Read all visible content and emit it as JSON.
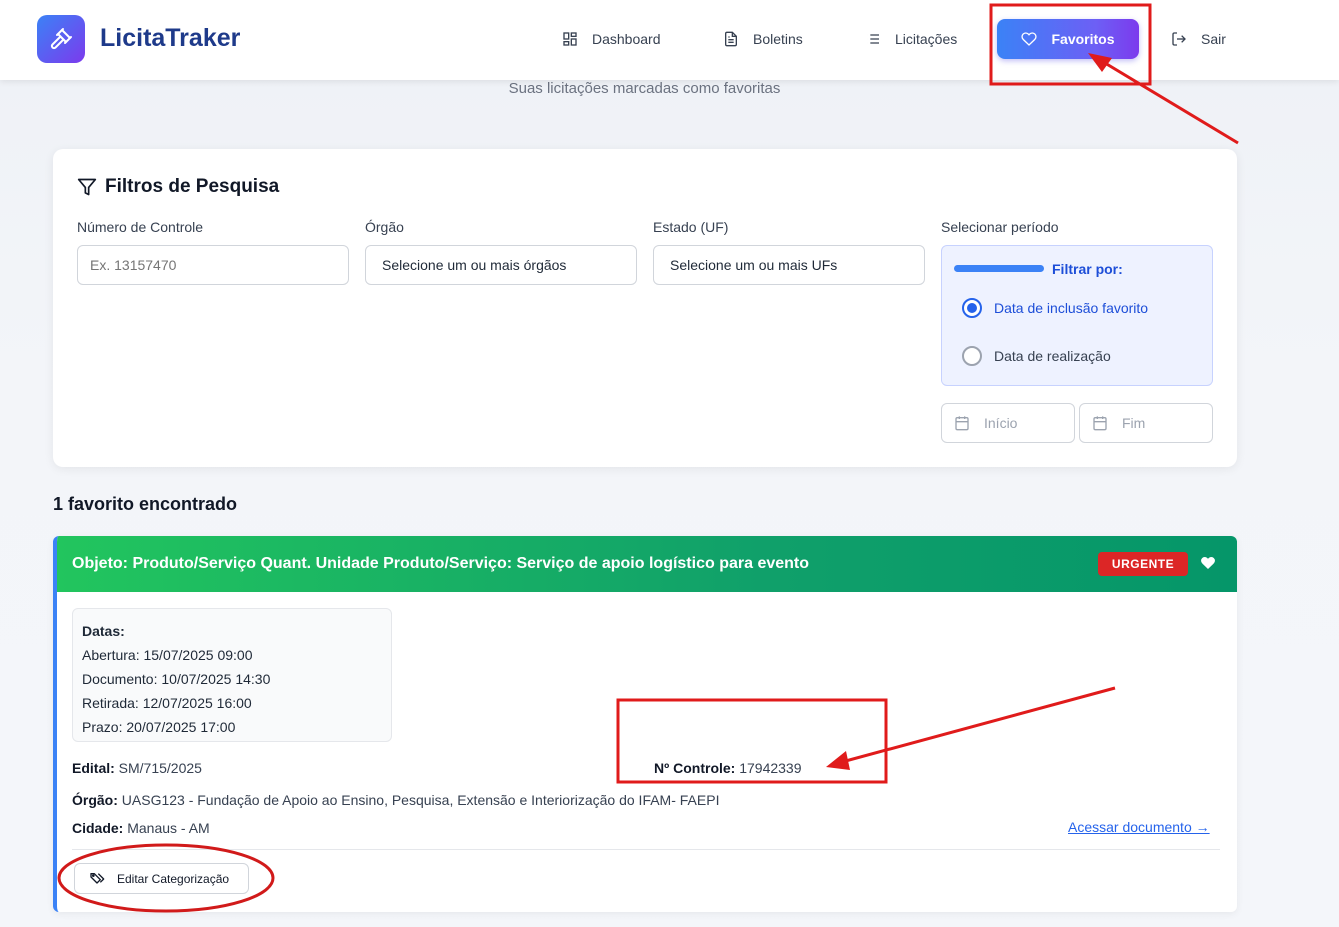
{
  "header": {
    "brand": "LicitaTraker",
    "nav": {
      "dashboard": "Dashboard",
      "boletins": "Boletins",
      "licitacoes": "Licitações",
      "favoritos": "Favoritos",
      "sair": "Sair"
    }
  },
  "page": {
    "subtitle": "Suas licitações marcadas como favoritas"
  },
  "filters": {
    "title": "Filtros de Pesquisa",
    "controle_label": "Número de Controle",
    "controle_placeholder": "Ex. 13157470",
    "orgao_label": "Órgão",
    "orgao_value": "Selecione um ou mais órgãos",
    "uf_label": "Estado (UF)",
    "uf_value": "Selecione um ou mais UFs",
    "period_label": "Selecionar período",
    "filter_by": "Filtrar por:",
    "option_inclusao": "Data de inclusão favorito",
    "option_realizacao": "Data de realização",
    "selected_option": "Data de inclusão favorito",
    "start_placeholder": "Início",
    "end_placeholder": "Fim"
  },
  "results": {
    "count_text": "1 favorito encontrado",
    "items": [
      {
        "objeto": "Objeto: Produto/Serviço Quant. Unidade Produto/Serviço: Serviço de apoio logístico para evento",
        "badge": "URGENTE",
        "datas_title": "Datas:",
        "abertura_label": "Abertura:",
        "abertura": "15/07/2025 09:00",
        "documento_label": "Documento:",
        "documento": "10/07/2025 14:30",
        "retirada_label": "Retirada:",
        "retirada": "12/07/2025 16:00",
        "prazo_label": "Prazo:",
        "prazo": "20/07/2025 17:00",
        "edital_label": "Edital:",
        "edital": "SM/715/2025",
        "controle_label": "Nº Controle:",
        "controle": "17942339",
        "orgao_label": "Órgão:",
        "orgao": "UASG123 - Fundação de Apoio ao Ensino, Pesquisa, Extensão e Interiorização do IFAM- FAEPI",
        "cidade_label": "Cidade:",
        "cidade": "Manaus - AM",
        "doc_link": "Acessar documento →",
        "edit_button": "Editar Categorização"
      }
    ]
  },
  "colors": {
    "accent_blue": "#3b82f6",
    "accent_purple": "#7c3aed",
    "header_green": "#10a06a",
    "urgent_red": "#dc2626",
    "annotation_red": "#e01b1b"
  }
}
